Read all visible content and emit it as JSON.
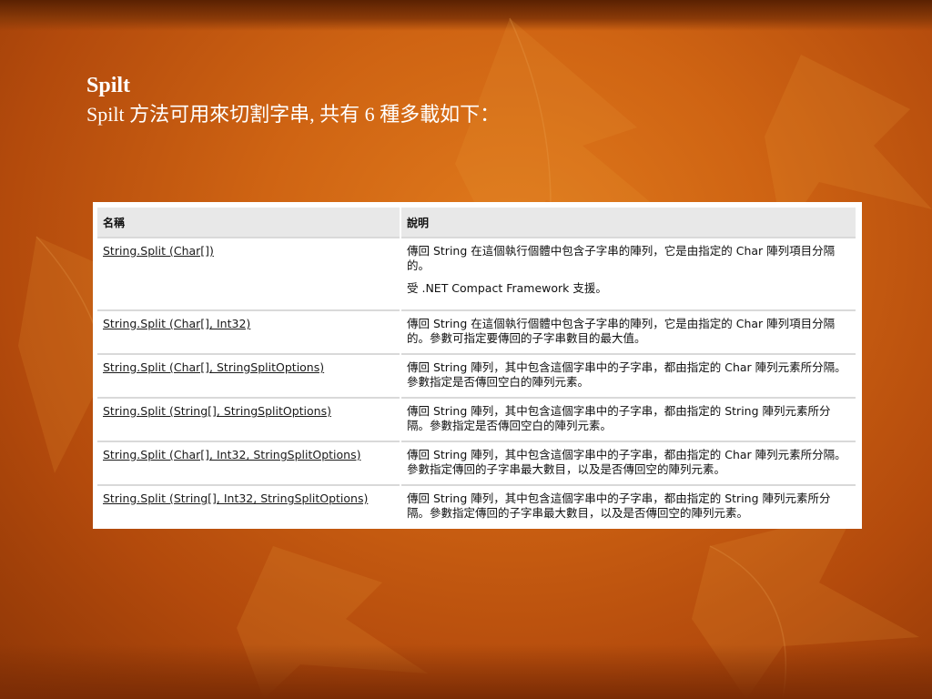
{
  "slide": {
    "title": "Spilt",
    "subtitle": "Spilt 方法可用來切割字串, 共有 6 種多載如下："
  },
  "table": {
    "headers": [
      "名稱",
      "說明"
    ],
    "rows": [
      {
        "name": "String.Split (Char[])",
        "desc": [
          "傳回 String 在這個執行個體中包含子字串的陣列，它是由指定的 Char 陣列項目分隔的。",
          "受 .NET Compact Framework 支援。"
        ]
      },
      {
        "name": "String.Split (Char[], Int32)",
        "desc": [
          "傳回 String 在這個執行個體中包含子字串的陣列，它是由指定的 Char 陣列項目分隔的。參數可指定要傳回的子字串數目的最大值。"
        ]
      },
      {
        "name": "String.Split (Char[], StringSplitOptions)",
        "desc": [
          "傳回 String 陣列，其中包含這個字串中的子字串，都由指定的 Char 陣列元素所分隔。參數指定是否傳回空白的陣列元素。"
        ]
      },
      {
        "name": "String.Split (String[], StringSplitOptions)",
        "desc": [
          "傳回 String 陣列，其中包含這個字串中的子字串，都由指定的 String 陣列元素所分隔。參數指定是否傳回空白的陣列元素。"
        ]
      },
      {
        "name": "String.Split (Char[], Int32, StringSplitOptions)",
        "desc": [
          "傳回 String 陣列，其中包含這個字串中的子字串，都由指定的 Char 陣列元素所分隔。參數指定傳回的子字串最大數目，以及是否傳回空的陣列元素。"
        ]
      },
      {
        "name": "String.Split (String[], Int32, StringSplitOptions)",
        "desc": [
          "傳回 String 陣列，其中包含這個字串中的子字串，都由指定的 String 陣列元素所分隔。參數指定傳回的子字串最大數目，以及是否傳回空的陣列元素。"
        ]
      }
    ]
  }
}
